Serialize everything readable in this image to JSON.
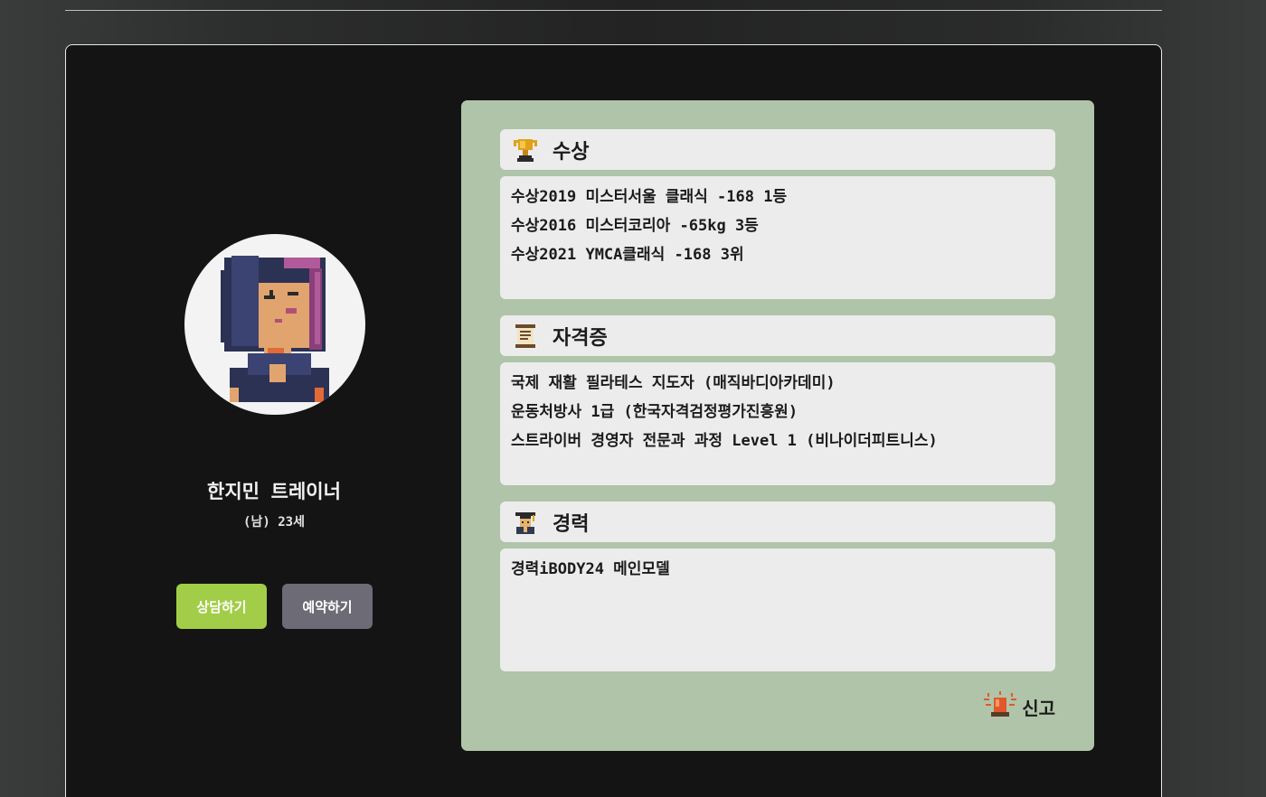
{
  "profile": {
    "name": "한지민 트레이너",
    "meta": "(남) 23세",
    "avatar_icon": "pixel-avatar-icon"
  },
  "actions": {
    "consult_label": "상담하기",
    "reserve_label": "예약하기",
    "consult_color": "#a2cd48",
    "reserve_color": "#6c6b76"
  },
  "sections": {
    "awards": {
      "icon": "trophy-icon",
      "title": "수상",
      "items": [
        "수상2019 미스터서울 클래식 -168 1등",
        "수상2016 미스터코리아 -65kg 3등",
        "수상2021 YMCA클래식 -168 3위"
      ]
    },
    "certificates": {
      "icon": "scroll-icon",
      "title": "자격증",
      "items": [
        "국제 재활 필라테스 지도자 (매직바디아카데미)",
        "운동처방사 1급 (한국자격검정평가진흥원)",
        "스트라이버 경영자 전문과 과정 Level 1 (비나이더피트니스)"
      ]
    },
    "career": {
      "icon": "graduate-icon",
      "title": "경력",
      "items": [
        "경력iBODY24 메인모델"
      ]
    }
  },
  "report": {
    "icon": "siren-icon",
    "label": "신고"
  },
  "colors": {
    "panel": "#afc4a9",
    "card": "#141414"
  }
}
